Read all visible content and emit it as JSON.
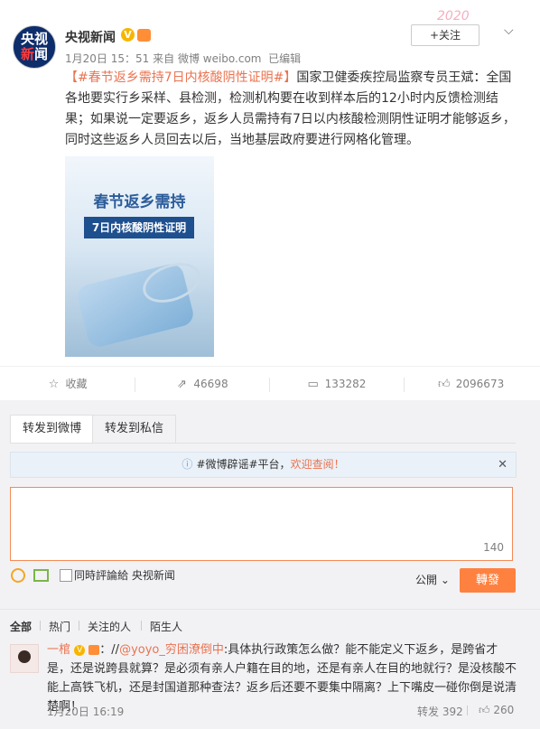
{
  "header": {
    "avatar_text_1": "央视",
    "avatar_text_2": "新",
    "avatar_text_3": "闻",
    "name": "央视新闻",
    "time": "1月20日 15：51",
    "source_prefix": "来自",
    "source": "微博 weibo.com",
    "edited": "已编辑",
    "follow": "+关注",
    "watermark": "2020"
  },
  "post": {
    "hashtag": "【#春节返乡需持7日内核酸阴性证明#】",
    "body": "国家卫健委疾控局监察专员王斌：全国各地要实行乡采样、县检测，检测机构要在收到样本后的12小时内反馈检测结果；如果说一定要返乡，返乡人员需持有7日以内核酸检测阴性证明才能够返乡，同时这些返乡人员回去以后，当地基层政府要进行网格化管理。",
    "image_title": "春节返乡需持",
    "image_subtitle": "7日内核酸阴性证明"
  },
  "actions": {
    "favorite": "收藏",
    "reposts": "46698",
    "comments": "133282",
    "likes": "2096673"
  },
  "repost_panel": {
    "tab_weibo": "转发到微博",
    "tab_private": "转发到私信",
    "notice_prefix": "#微博辟谣#平台，",
    "notice_link": "欢迎查阅！",
    "counter": "140",
    "also_comment": "同時評論給 央视新闻",
    "visibility": "公開",
    "submit": "轉發"
  },
  "filters": [
    "全部",
    "热门",
    "关注的人",
    "陌生人"
  ],
  "comment": {
    "user": "一棺",
    "prefix": "：//",
    "mention": "@yoyo_穷困潦倒中",
    "text": ":具体执行政策怎么做？能不能定义下返乡，是跨省才是，还是说跨县就算？是必须有亲人户籍在目的地，还是有亲人在目的地就行？是没核酸不能上高铁飞机，还是封国道那种查法？返乡后还要不要集中隔离？上下嘴皮一碰你倒是说清楚啊！",
    "date": "1月20日 16:19",
    "reposts": "转发 392",
    "likes": "260"
  }
}
